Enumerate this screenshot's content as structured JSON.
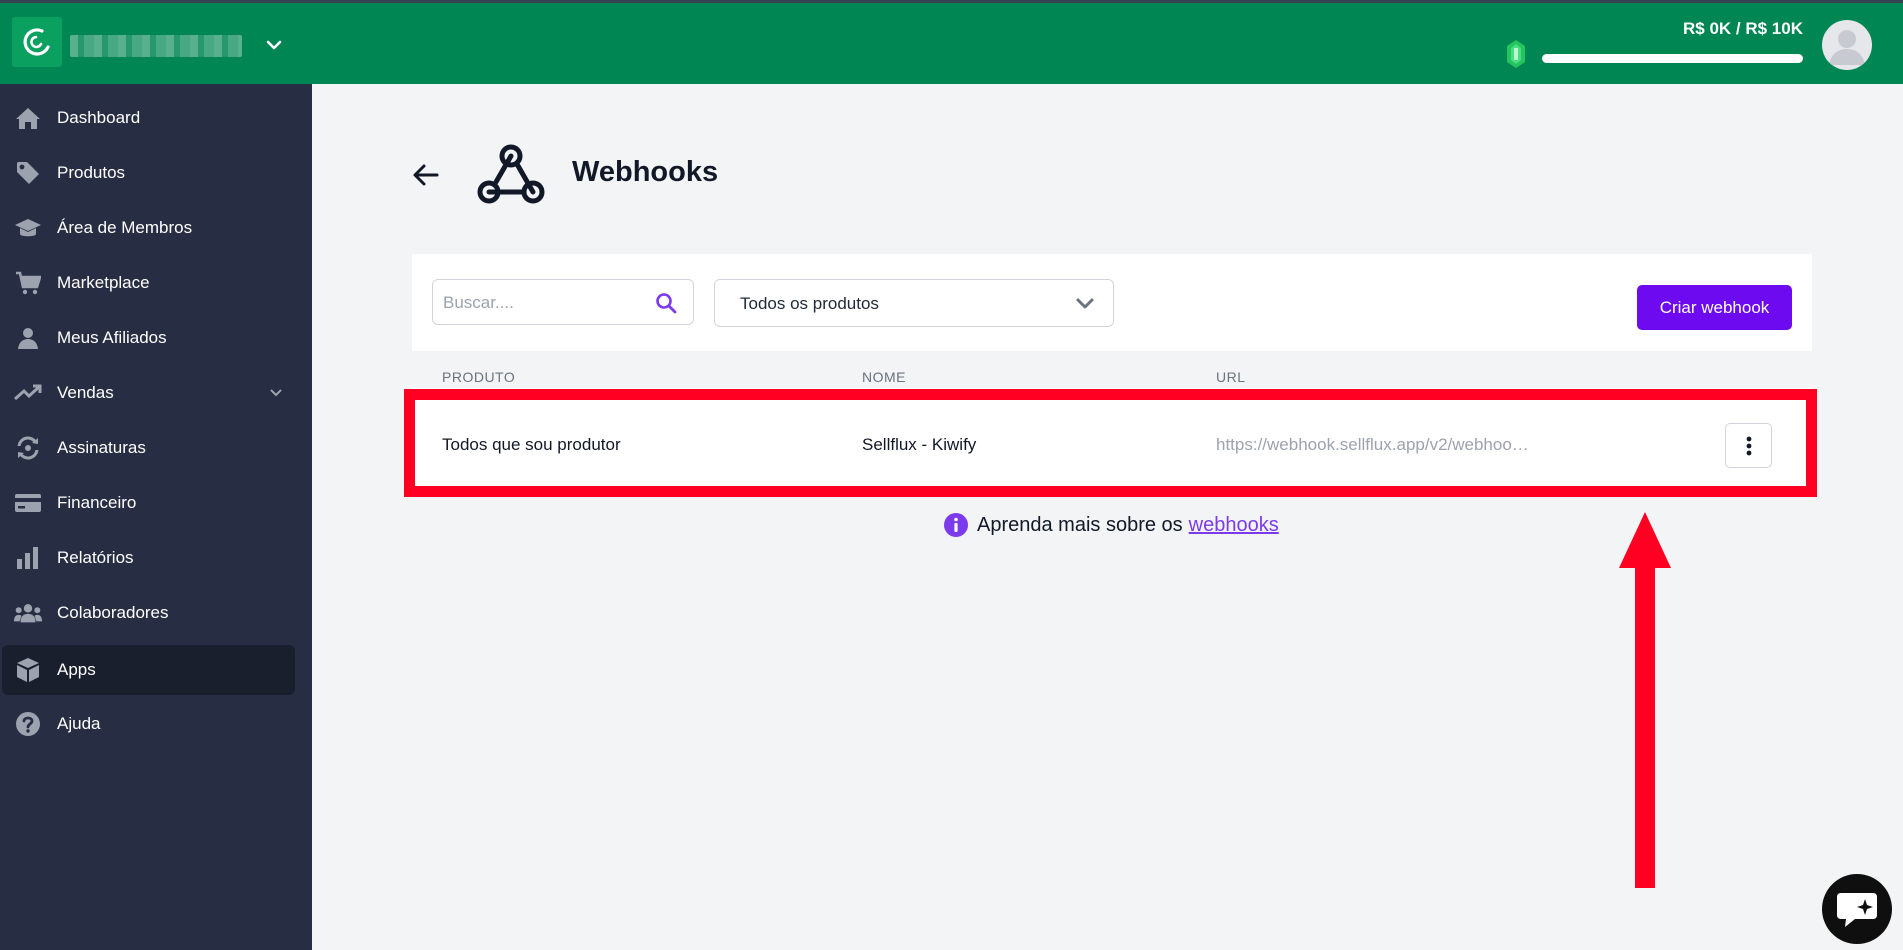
{
  "topbar": {
    "store_name": "▒▒▒▒▒▒▒▒▒▒▒▒ ..",
    "goal_label": "R$ 0K / R$ 10K",
    "goal_progress": 0.0
  },
  "sidebar": {
    "items": [
      {
        "label": "Dashboard",
        "icon": "home-icon"
      },
      {
        "label": "Produtos",
        "icon": "tag-icon"
      },
      {
        "label": "Área de Membros",
        "icon": "graduation-cap-icon"
      },
      {
        "label": "Marketplace",
        "icon": "cart-icon"
      },
      {
        "label": "Meus Afiliados",
        "icon": "user-icon"
      },
      {
        "label": "Vendas",
        "icon": "trending-up-icon"
      },
      {
        "label": "Assinaturas",
        "icon": "refresh-icon"
      },
      {
        "label": "Financeiro",
        "icon": "credit-card-icon"
      },
      {
        "label": "Relatórios",
        "icon": "bar-chart-icon"
      },
      {
        "label": "Colaboradores",
        "icon": "users-icon"
      },
      {
        "label": "Apps",
        "icon": "cube-icon"
      },
      {
        "label": "Ajuda",
        "icon": "help-icon"
      }
    ],
    "active": "Apps"
  },
  "page": {
    "title": "Webhooks"
  },
  "toolbar": {
    "search_placeholder": "Buscar....",
    "filter_value": "Todos os produtos",
    "create_label": "Criar webhook"
  },
  "table": {
    "headers": [
      "PRODUTO",
      "NOME",
      "URL"
    ],
    "rows": [
      {
        "produto": "Todos que sou produtor",
        "nome": "Sellflux - Kiwify",
        "url": "https://webhook.sellflux.app/v2/webhoo…"
      }
    ]
  },
  "info": {
    "text": "Aprenda mais sobre os",
    "link": "webhooks"
  },
  "colors": {
    "topbar": "#008653",
    "sidebar": "#272d42",
    "accent": "#6d0af0",
    "highlight": "#ff0022"
  }
}
